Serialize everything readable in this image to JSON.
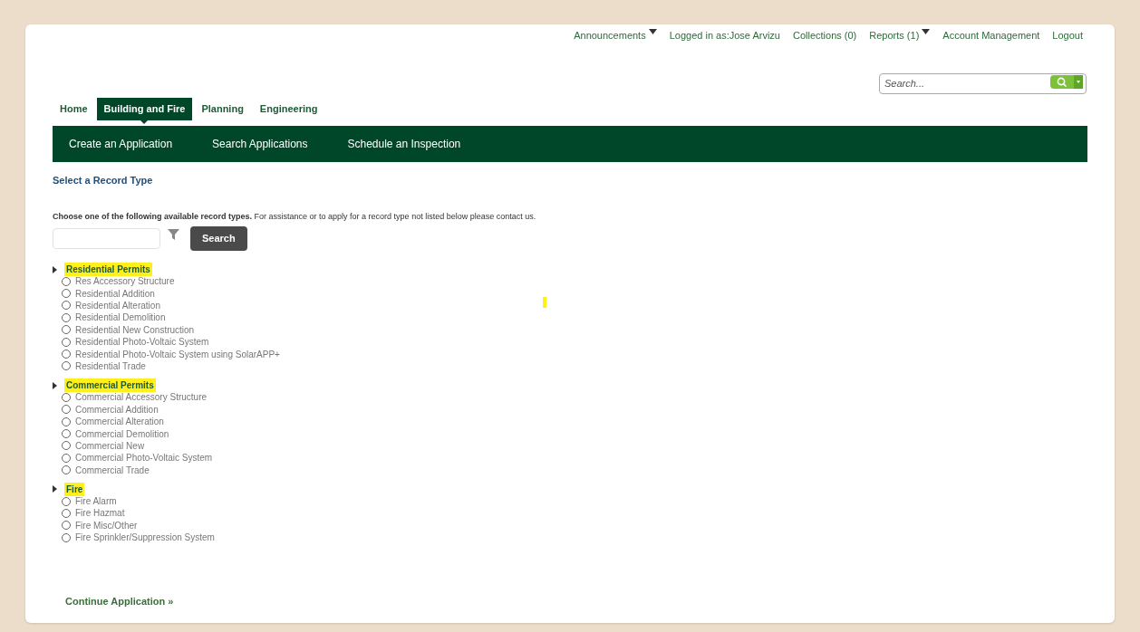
{
  "top_links": [
    {
      "label": "Announcements",
      "kind": "dropdown"
    },
    {
      "label": "Logged in as:Jose Arvizu",
      "kind": "link"
    },
    {
      "label": "Collections (0)",
      "kind": "link"
    },
    {
      "label": "Reports (1)",
      "kind": "dropdown"
    },
    {
      "label": "Account Management",
      "kind": "link"
    },
    {
      "label": "Logout",
      "kind": "link"
    }
  ],
  "global_search": {
    "placeholder": "Search..."
  },
  "tabs": [
    {
      "label": "Home",
      "selected": false
    },
    {
      "label": "Building and Fire",
      "selected": true
    },
    {
      "label": "Planning",
      "selected": false
    },
    {
      "label": "Engineering",
      "selected": false
    }
  ],
  "sub_nav": [
    "Create an Application",
    "Search Applications",
    "Schedule an Inspection"
  ],
  "page_title": "Select a Record Type",
  "instructions": "**Choose one of the following available record types.** For assistance or to apply for a record type not listed below please contact us.",
  "filter_button": "Search",
  "groups": [
    {
      "label": "Residential Permits",
      "highlighted": true,
      "items": [
        {
          "label": "Res Accessory Structure",
          "selected": false
        },
        {
          "label": "Residential Addition",
          "selected": false
        },
        {
          "label": "Residential Alteration",
          "selected": false
        },
        {
          "label": "Residential Demolition",
          "selected": false
        },
        {
          "label": "Residential New Construction",
          "selected": false
        },
        {
          "label": "Residential Photo-Voltaic System",
          "selected": false
        },
        {
          "label": "Residential Photo-Voltaic System using SolarAPP+",
          "selected": false
        },
        {
          "label": "Residential Trade",
          "selected": false
        }
      ]
    },
    {
      "label": "Commercial Permits",
      "highlighted": true,
      "items": [
        {
          "label": "Commercial Accessory Structure",
          "selected": false
        },
        {
          "label": "Commercial Addition",
          "selected": false
        },
        {
          "label": "Commercial Alteration",
          "selected": false
        },
        {
          "label": "Commercial Demolition",
          "selected": false
        },
        {
          "label": "Commercial New",
          "selected": false
        },
        {
          "label": "Commercial Photo-Voltaic System",
          "selected": false
        },
        {
          "label": "Commercial Trade",
          "selected": false
        }
      ]
    },
    {
      "label": "Fire",
      "highlighted": true,
      "items": [
        {
          "label": "Fire Alarm",
          "selected": false
        },
        {
          "label": "Fire Hazmat",
          "selected": false
        },
        {
          "label": "Fire Misc/Other",
          "selected": false
        },
        {
          "label": "Fire Sprinkler/Suppression System",
          "selected": false
        }
      ]
    }
  ],
  "continue_link": "Continue Application »"
}
